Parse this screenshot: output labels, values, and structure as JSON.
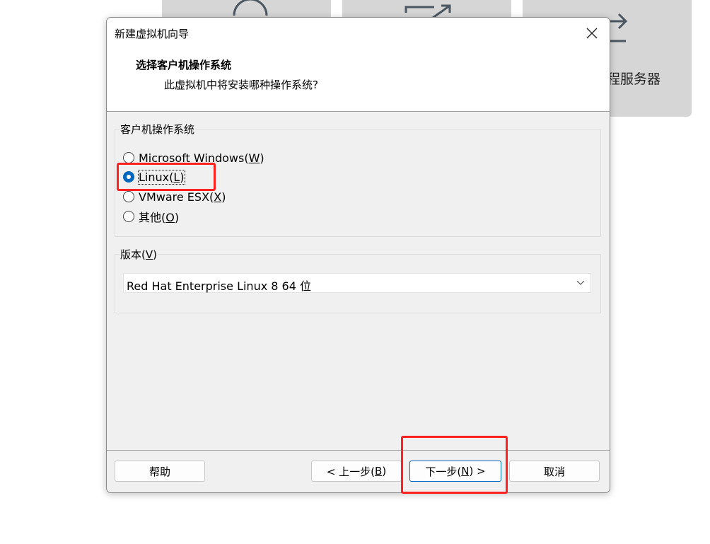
{
  "background": {
    "tile3_text": "程服务器"
  },
  "dialog": {
    "title": "新建虚拟机向导",
    "header": {
      "title": "选择客户机操作系统",
      "subtitle": "此虚拟机中将安装哪种操作系统?"
    },
    "os_group": {
      "label": "客户机操作系统",
      "options": [
        {
          "text": "Microsoft Windows(",
          "key": "W",
          "end": ")",
          "selected": false
        },
        {
          "text": "Linux(",
          "key": "L",
          "end": ")",
          "selected": true
        },
        {
          "text": "VMware ESX(",
          "key": "X",
          "end": ")",
          "selected": false
        },
        {
          "text": "其他(",
          "key": "O",
          "end": ")",
          "selected": false
        }
      ]
    },
    "version_group": {
      "label_text": "版本(",
      "label_key": "V",
      "label_end": ")",
      "selected_value": "Red Hat Enterprise Linux 8 64 位"
    },
    "buttons": {
      "help": "帮助",
      "back_text": "< 上一步(",
      "back_key": "B",
      "back_end": ")",
      "next_text": "下一步(",
      "next_key": "N",
      "next_end": ") >",
      "cancel": "取消"
    }
  },
  "colors": {
    "accent": "#0067c0",
    "annotation": "#ff2020"
  }
}
